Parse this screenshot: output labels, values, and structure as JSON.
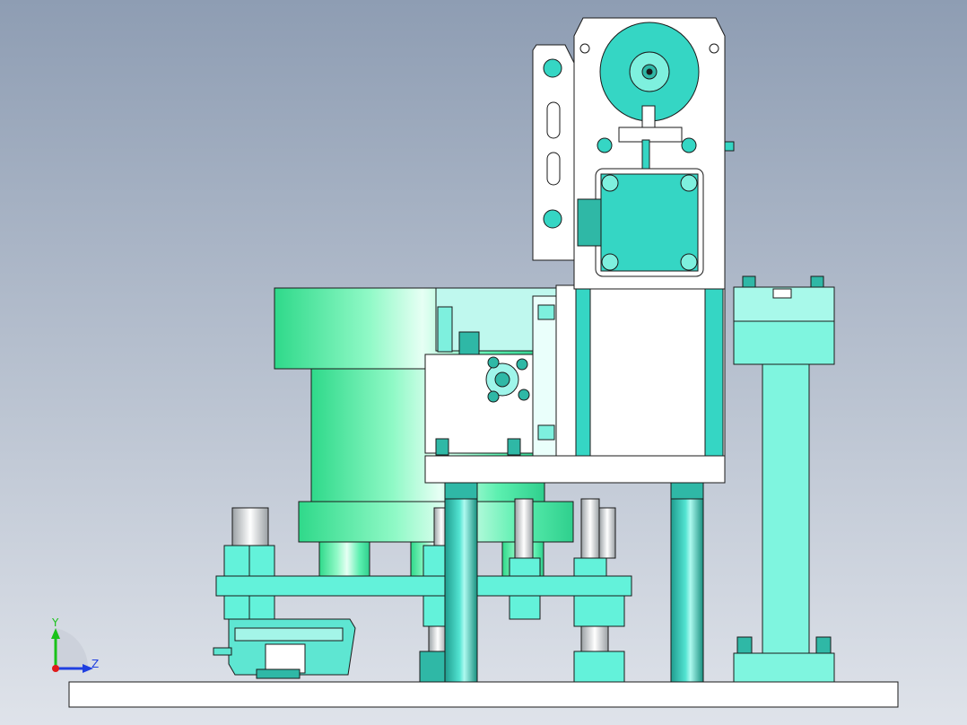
{
  "viewport": {
    "background_top": "#8e9db3",
    "background_bottom": "#dfe3ea",
    "accent_cyan": "#35d6c4",
    "accent_green": "#42f59a",
    "outline": "#1a1a1a"
  },
  "triad": {
    "y_label": "Y",
    "z_label": "Z",
    "y_color": "#19c219",
    "z_color": "#1f3fe0",
    "x_color": "#e01b1b"
  }
}
